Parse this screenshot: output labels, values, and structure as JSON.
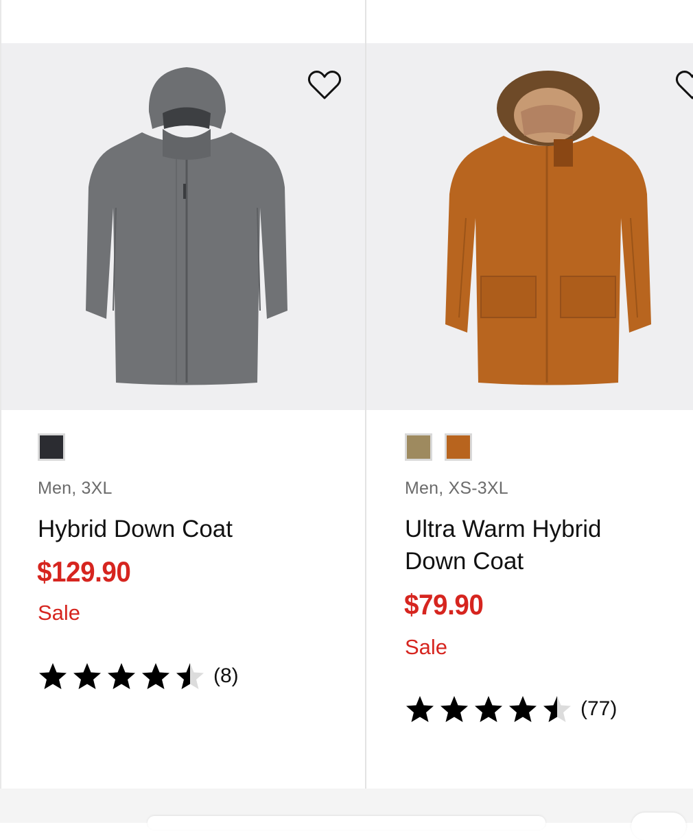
{
  "products": [
    {
      "id_label": "hybrid-down-coat",
      "image_icon": "gray-coat-image",
      "swatches": [
        {
          "color": "#2b2c31"
        }
      ],
      "meta": "Men, 3XL",
      "name": "Hybrid Down Coat",
      "price": "$129.90",
      "sale_label": "Sale",
      "rating": 4.5,
      "review_count": "(8)"
    },
    {
      "id_label": "ultra-warm-hybrid-down-coat",
      "image_icon": "brown-parka-image",
      "swatches": [
        {
          "color": "#9e8a5f"
        },
        {
          "color": "#b8641e"
        }
      ],
      "meta": "Men, XS-3XL",
      "name": "Ultra Warm Hybrid Down Coat",
      "price": "$79.90",
      "sale_label": "Sale",
      "rating": 4.5,
      "review_count": "(77)"
    }
  ],
  "colors": {
    "price_red": "#d6251f",
    "image_bg": "#efeff1",
    "divider": "#e3e3e3"
  }
}
